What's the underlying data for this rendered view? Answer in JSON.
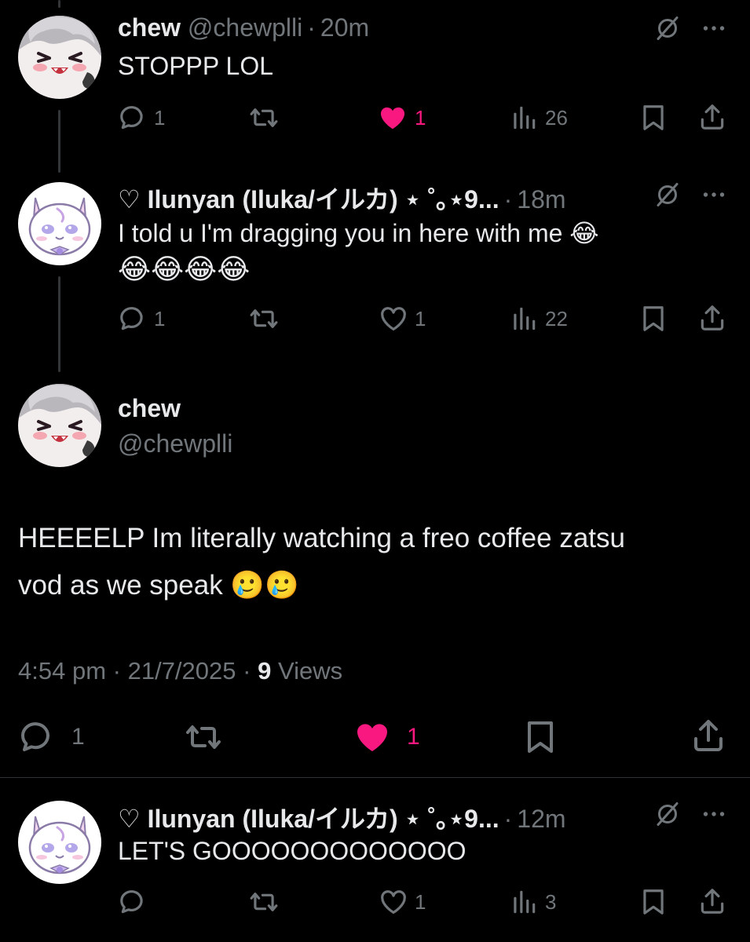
{
  "reply1": {
    "name": "chew",
    "handle": "@chewplli",
    "dot": "·",
    "time": "20m",
    "text": "STOPPP LOL",
    "replies": "1",
    "likes": "1",
    "views": "26",
    "liked": true
  },
  "reply2": {
    "name": "♡ Ilunyan (Iluka/イルカ) ⋆ ˚｡⋆9...",
    "dot": "·",
    "time": "18m",
    "text_line1": "I told u I'm dragging you in here with me 😂",
    "text_line2": "😂😂😂😂",
    "replies": "1",
    "likes": "1",
    "views": "22",
    "liked": false
  },
  "main": {
    "name": "chew",
    "handle": "@chewplli",
    "text_line1": "HEEEELP Im literally watching a freo coffee zatsu",
    "text_line2": "vod as we speak 🥲🥲",
    "time": "4:54 pm",
    "date": "21/7/2025",
    "dot": "·",
    "views_count": "9",
    "views_label": "Views",
    "replies": "1",
    "likes": "1",
    "liked": true
  },
  "reply3": {
    "name": "♡ Ilunyan (Iluka/イルカ) ⋆ ˚｡⋆9...",
    "dot": "·",
    "time": "12m",
    "text": "LET'S GOOOOOOOOOOOOO",
    "likes": "1",
    "views": "3",
    "liked": false
  },
  "colors": {
    "background": "#000000",
    "text": "#e7e9ea",
    "muted": "#71767b",
    "like_active": "#f91880"
  },
  "icons": [
    "grok-icon",
    "more-icon",
    "reply-icon",
    "retweet-icon",
    "like-icon",
    "views-icon",
    "bookmark-icon",
    "share-icon"
  ]
}
